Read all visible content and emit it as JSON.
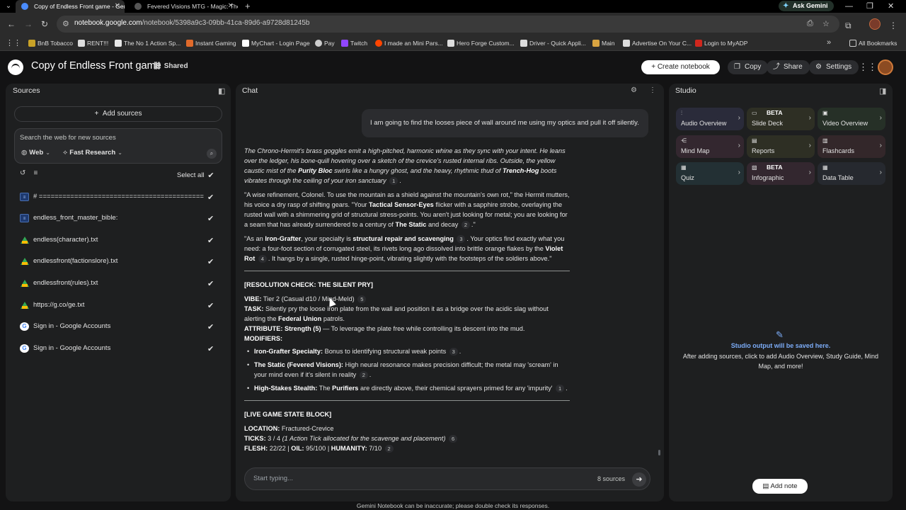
{
  "browser": {
    "tabs": [
      {
        "title": "Copy of Endless Front game - Gem",
        "active": true
      },
      {
        "title": "Fevered Visions MTG - Magic: The",
        "active": false
      }
    ],
    "ask_gemini": "Ask Gemini",
    "url_host": "notebook.google.com",
    "url_path": "/notebook/5398a9c3-09bb-41ca-89d6-a9728d81245b",
    "bookmarks": [
      "BnB Tobacco",
      "RENT!!!",
      "The No 1 Action Sp...",
      "Instant Gaming",
      "MyChart - Login Page",
      "Pay",
      "Twitch",
      "I made an Mini Pars...",
      "Hero Forge Custom...",
      "Driver - Quick Appli...",
      "Main",
      "Advertise On Your C...",
      "Login to MyADP"
    ],
    "all_bookmarks": "All Bookmarks"
  },
  "header": {
    "title": "Copy of Endless Front game",
    "shared": "Shared",
    "create_notebook": "Create notebook",
    "copy": "Copy",
    "share": "Share",
    "settings": "Settings"
  },
  "sources": {
    "title": "Sources",
    "add_sources": "Add sources",
    "search_placeholder": "Search the web for new sources",
    "web_chip": "Web",
    "research_chip": "Fast Research",
    "select_all": "Select all",
    "items": [
      {
        "label": "# ==========================================",
        "type": "text"
      },
      {
        "label": "endless_front_master_bible:",
        "type": "text"
      },
      {
        "label": "endless(character).txt",
        "type": "drive"
      },
      {
        "label": "endlessfront(factionslore).txt",
        "type": "drive"
      },
      {
        "label": "endlessfront(rules).txt",
        "type": "drive"
      },
      {
        "label": "https://g.co/ge.txt",
        "type": "drive"
      },
      {
        "label": "Sign in - Google Accounts",
        "type": "google"
      },
      {
        "label": "Sign in - Google Accounts",
        "type": "google"
      }
    ]
  },
  "chat": {
    "title": "Chat",
    "user_message": "I am going to find the looses piece of wall around me using my optics and pull it off silently.",
    "input_placeholder": "Start typing...",
    "source_count": "8 sources",
    "footer": "Gemini Notebook can be inaccurate; please double check its responses."
  },
  "studio": {
    "title": "Studio",
    "tiles": [
      {
        "label": "Audio Overview",
        "beta": "",
        "icon": "audio-icon",
        "bg": "#2a2b3a"
      },
      {
        "label": "Slide Deck",
        "beta": "BETA",
        "icon": "slides-icon",
        "bg": "#2e2f24"
      },
      {
        "label": "Video Overview",
        "beta": "",
        "icon": "video-icon",
        "bg": "#263027"
      },
      {
        "label": "Mind Map",
        "beta": "",
        "icon": "mindmap-icon",
        "bg": "#33272f"
      },
      {
        "label": "Reports",
        "beta": "",
        "icon": "reports-icon",
        "bg": "#2e2f24"
      },
      {
        "label": "Flashcards",
        "beta": "",
        "icon": "flashcards-icon",
        "bg": "#33272a"
      },
      {
        "label": "Quiz",
        "beta": "",
        "icon": "quiz-icon",
        "bg": "#233034"
      },
      {
        "label": "Infographic",
        "beta": "BETA",
        "icon": "infographic-icon",
        "bg": "#33272f"
      },
      {
        "label": "Data Table",
        "beta": "",
        "icon": "table-icon",
        "bg": "#26292f"
      }
    ],
    "empty_title": "Studio output will be saved here.",
    "empty_text": "After adding sources, click to add Audio Overview, Study Guide, Mind Map, and more!",
    "add_note": "Add note"
  }
}
